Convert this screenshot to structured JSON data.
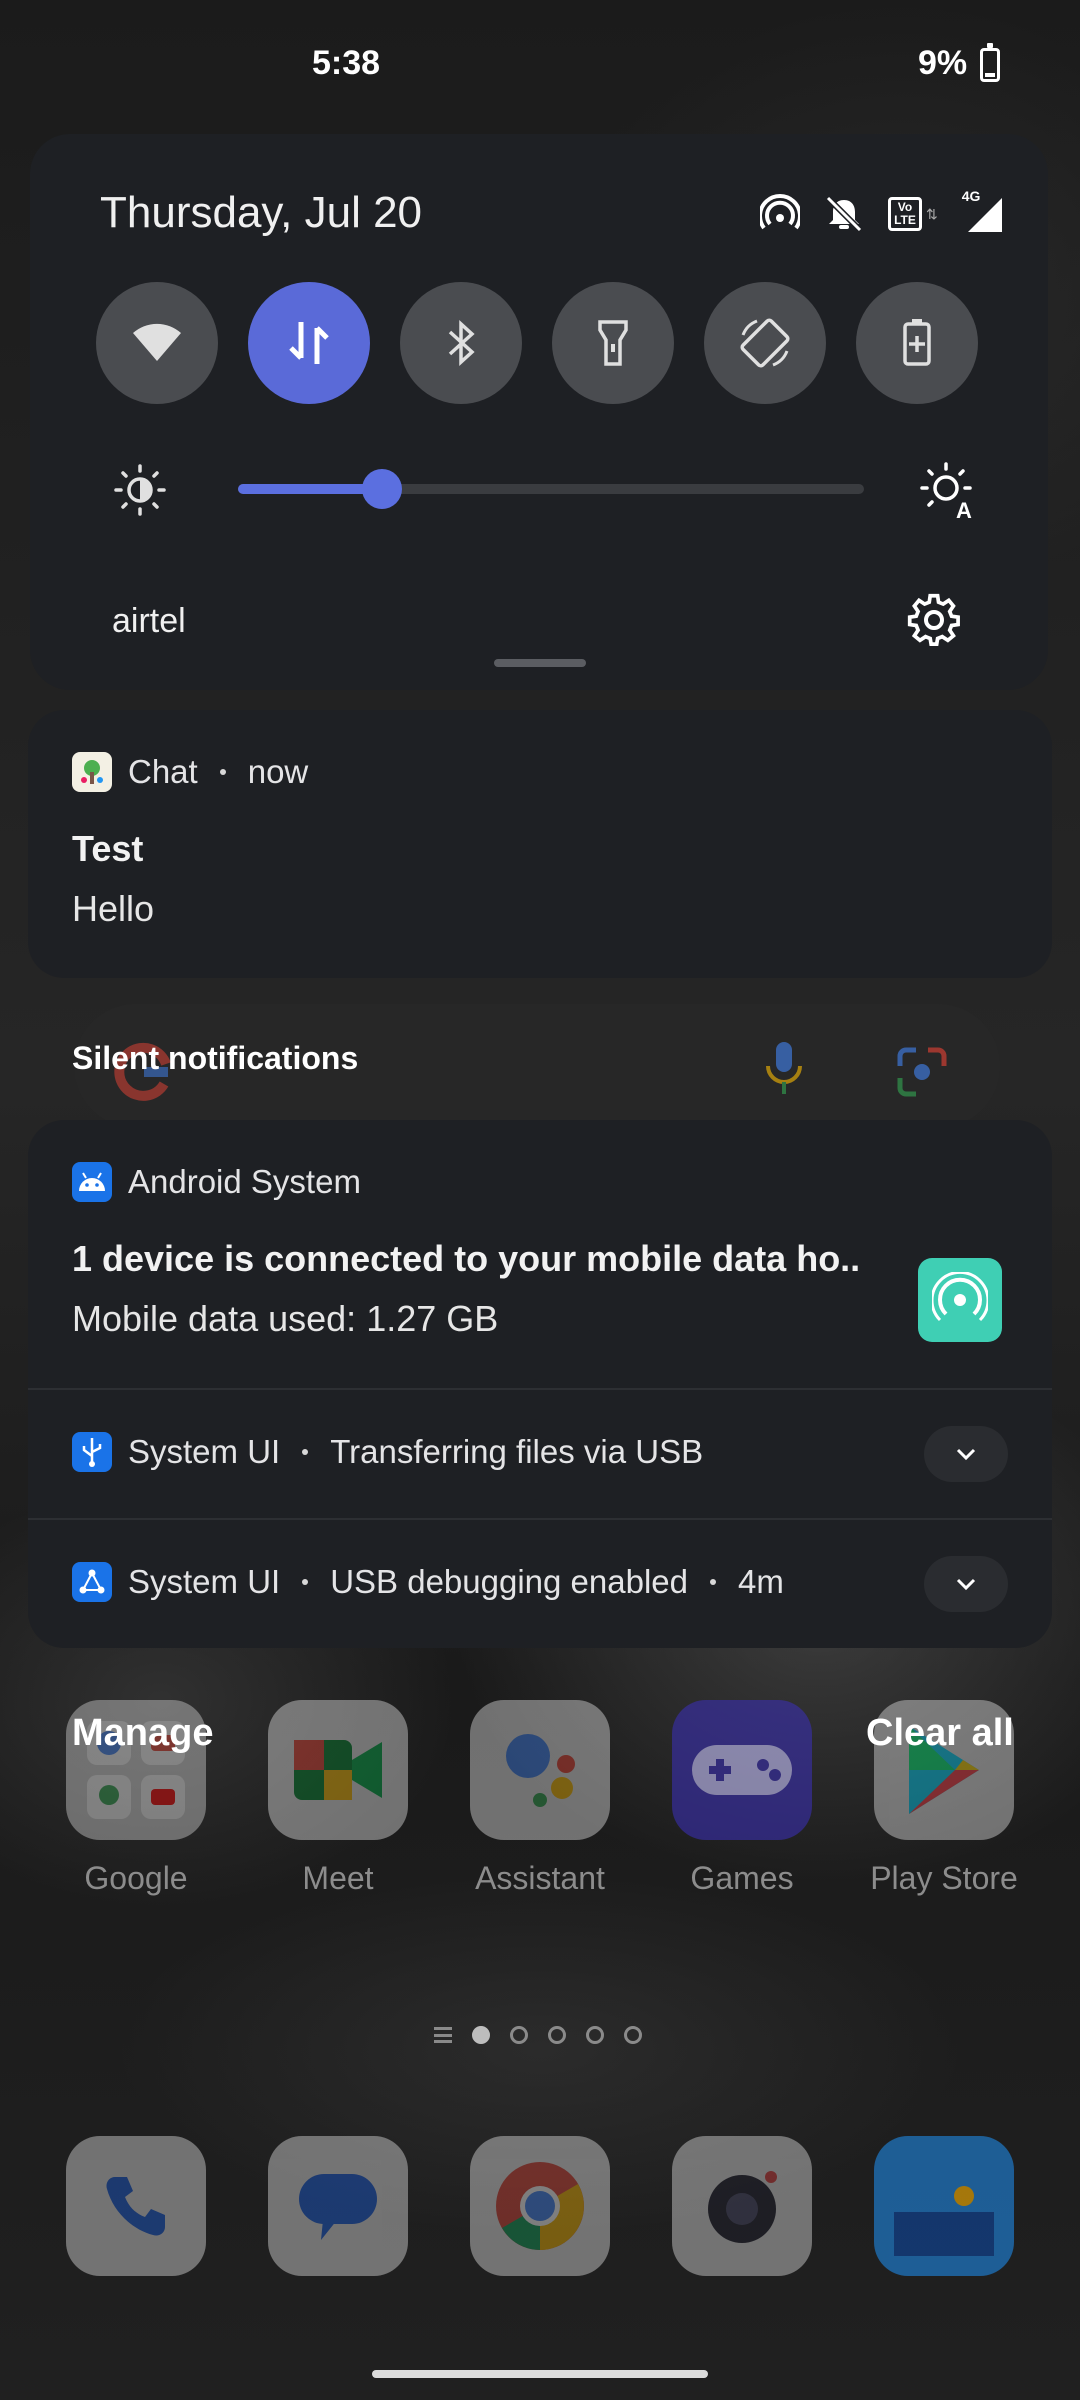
{
  "status_bar": {
    "time": "5:38",
    "battery": "9%"
  },
  "quick_settings": {
    "date": "Thursday, Jul 20",
    "carrier": "airtel",
    "network_badge": "4G",
    "volte_badge": "Vo LTE",
    "tiles": [
      "wifi-icon",
      "mobile-data-icon",
      "bluetooth-icon",
      "flashlight-icon",
      "auto-rotate-icon",
      "battery-saver-icon"
    ],
    "brightness_level": 0.23
  },
  "notifications": {
    "chat": {
      "app": "Chat",
      "time": "now",
      "title": "Test",
      "text": "Hello"
    },
    "silent_header": "Silent notifications",
    "android_system": {
      "app": "Android System",
      "title": "1 device is connected to your mobile data ho..",
      "text": "Mobile data used: 1.27 GB"
    },
    "usb_transfer": {
      "app": "System UI",
      "text": "Transferring files via USB"
    },
    "usb_debugging": {
      "app": "System UI",
      "text": "USB debugging enabled",
      "time": "4m"
    }
  },
  "actions": {
    "manage": "Manage",
    "clear_all": "Clear all"
  },
  "home": {
    "apps": [
      "Google",
      "Meet",
      "Assistant",
      "Games",
      "Play Store"
    ],
    "dock": [
      "phone-icon",
      "messages-icon",
      "chrome-icon",
      "camera-icon",
      "gallery-icon"
    ]
  },
  "colors": {
    "accent": "#5a6ad8",
    "card": "#1e2024",
    "hotspot_teal": "#3fcfb4"
  }
}
